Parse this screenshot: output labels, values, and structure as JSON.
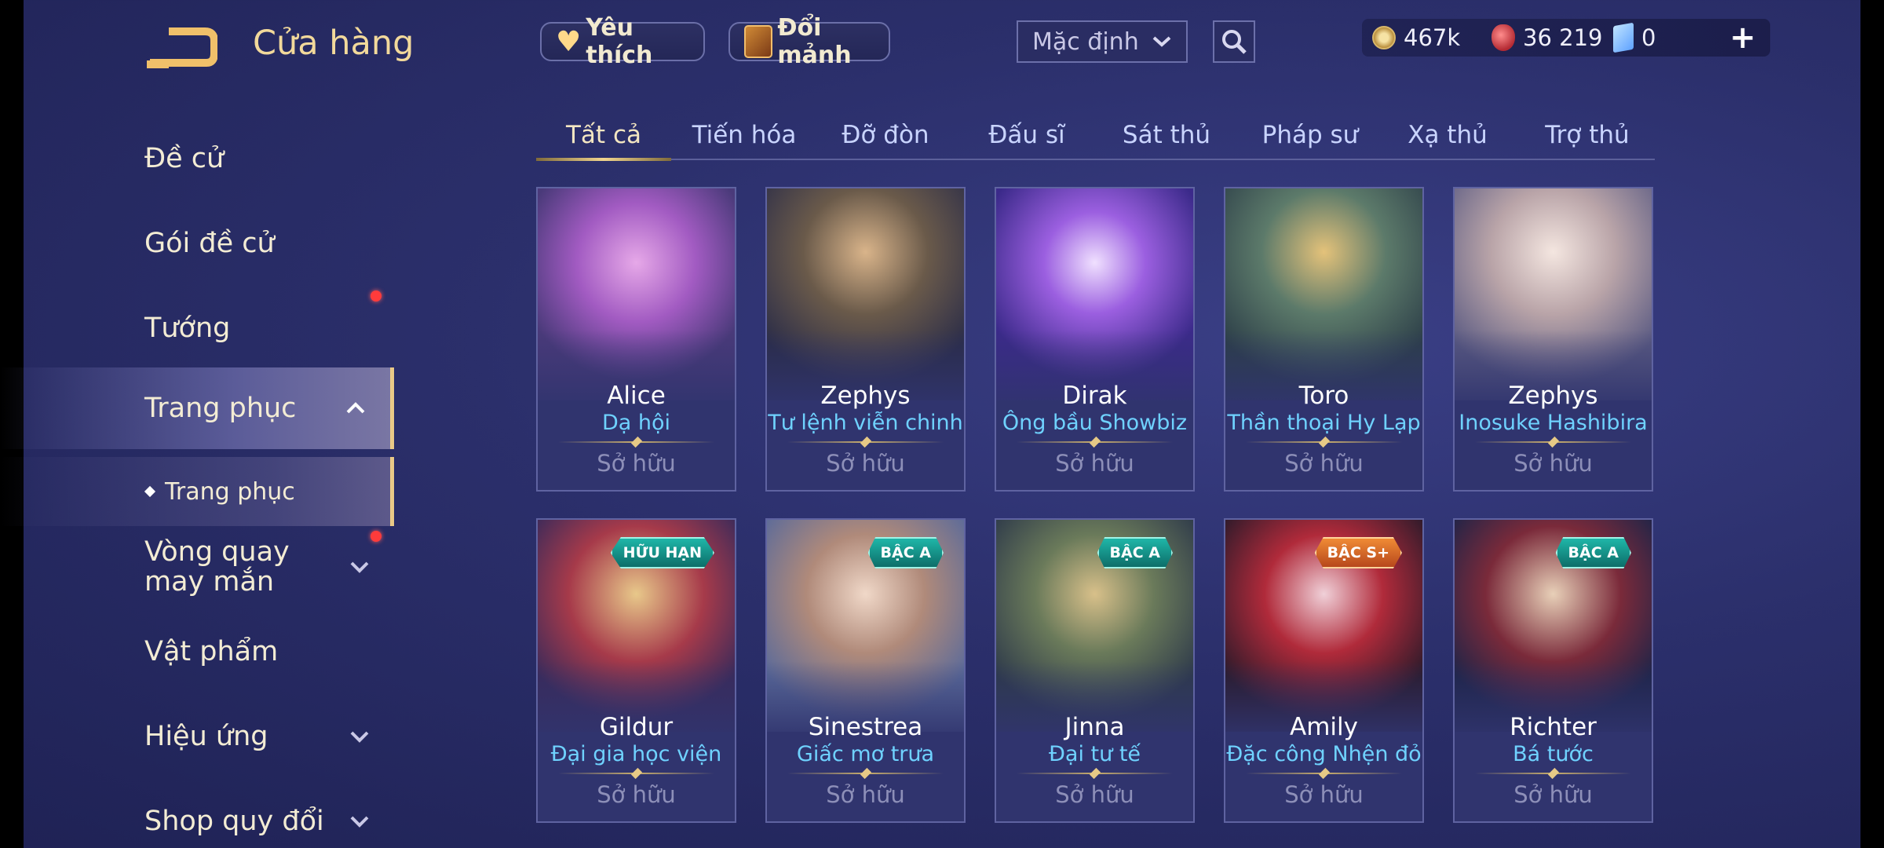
{
  "header": {
    "title": "Cửa hàng",
    "favorites_label": "Yêu thích",
    "shard_label": "Đổi mảnh",
    "sort_value": "Mặc định",
    "currencies": {
      "gold": "467k",
      "ruby": "36 219",
      "voucher": "0"
    }
  },
  "sidebar": {
    "items": [
      {
        "label": "Đề cử"
      },
      {
        "label": "Gói đề cử"
      },
      {
        "label": "Tướng"
      },
      {
        "label": "Trang phục"
      },
      {
        "label": "Trang phục"
      },
      {
        "label": "Vòng quay may mắn"
      },
      {
        "label": "Vật phẩm"
      },
      {
        "label": "Hiệu ứng"
      },
      {
        "label": "Shop quy đổi"
      }
    ]
  },
  "tabs": [
    "Tất cả",
    "Tiến hóa",
    "Đỡ đòn",
    "Đấu sĩ",
    "Sát thủ",
    "Pháp sư",
    "Xạ thủ",
    "Trợ thủ"
  ],
  "cards": [
    {
      "hero": "Alice",
      "skin": "Dạ hội",
      "status": "Sở hữu"
    },
    {
      "hero": "Zephys",
      "skin": "Tư lệnh viễn chinh",
      "status": "Sở hữu"
    },
    {
      "hero": "Dirak",
      "skin": "Ông bầu Showbiz",
      "status": "Sở hữu"
    },
    {
      "hero": "Toro",
      "skin": "Thần thoại Hy Lạp",
      "status": "Sở hữu"
    },
    {
      "hero": "Zephys",
      "skin": "Inosuke Hashibira",
      "status": "Sở hữu"
    },
    {
      "hero": "Gildur",
      "skin": "Đại gia học viện",
      "status": "Sở hữu",
      "badge": "HỮU HẠN"
    },
    {
      "hero": "Sinestrea",
      "skin": "Giấc mơ trưa",
      "status": "Sở hữu",
      "badge": "BẬC A"
    },
    {
      "hero": "Jinna",
      "skin": "Đại tư tế",
      "status": "Sở hữu",
      "badge": "BẬC A"
    },
    {
      "hero": "Amily",
      "skin": "Đặc công Nhện đỏ",
      "status": "Sở hữu",
      "badge": "BẬC S+"
    },
    {
      "hero": "Richter",
      "skin": "Bá tước",
      "status": "Sở hữu",
      "badge": "BẬC A"
    }
  ],
  "colors": {
    "accent_gold": "#e9c987",
    "skin_name": "#6fd2ff",
    "background": "#2b2f6b"
  }
}
